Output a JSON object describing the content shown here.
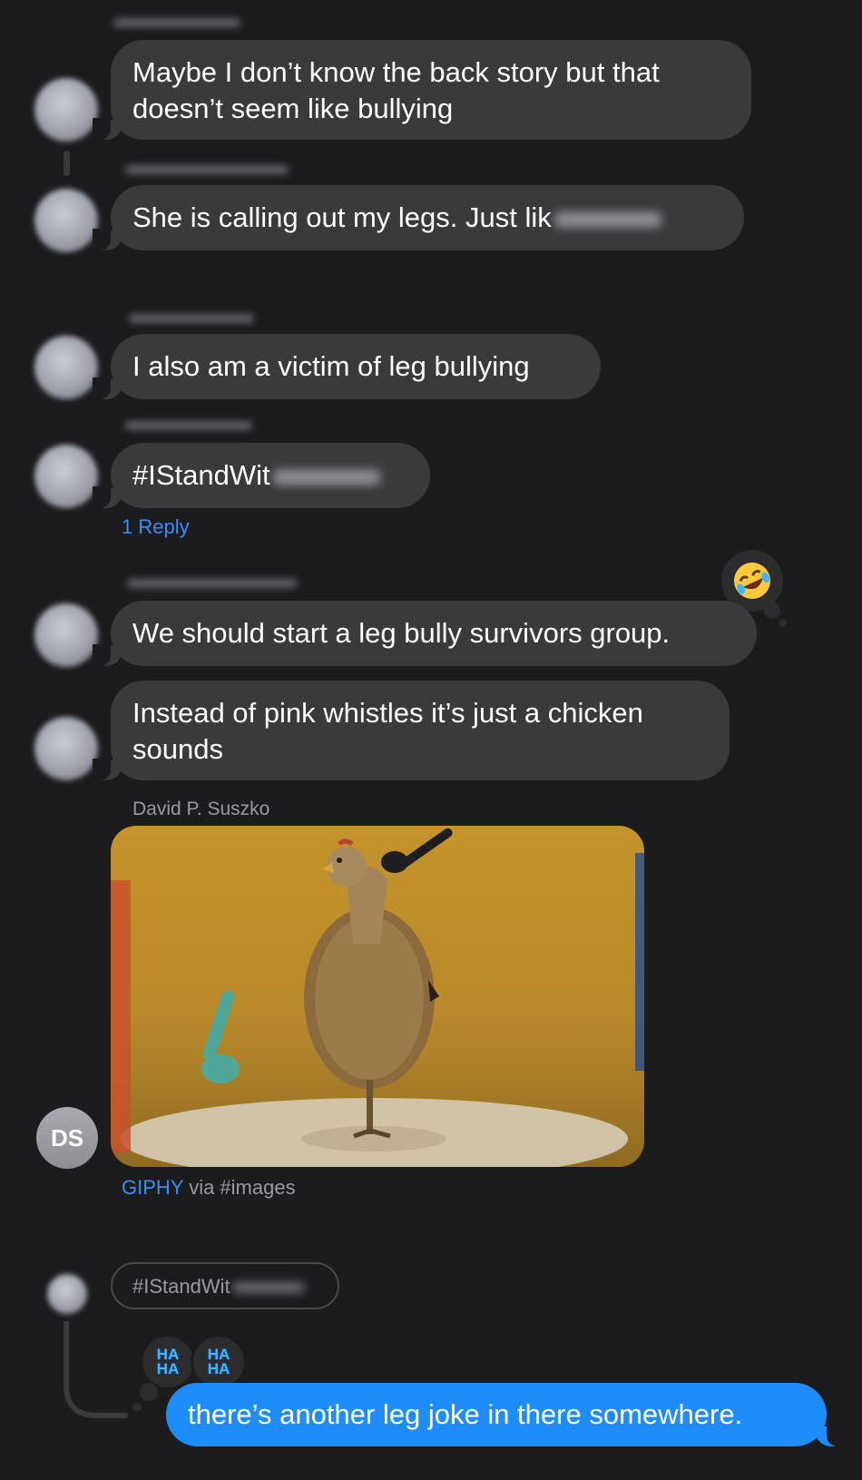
{
  "messages": [
    {
      "text": "Maybe I don’t know the back story but that doesn’t seem like bullying"
    },
    {
      "text": "She is calling out my legs. Just lik"
    },
    {
      "text": "I also am a victim of leg bullying"
    },
    {
      "text": "#IStandWit",
      "reply_count_label": "1 Reply"
    },
    {
      "text": "We should start a leg bully survivors group.",
      "reaction": "rolling-on-floor-laughing"
    },
    {
      "text": "Instead of pink whistles it’s just a chicken sounds"
    }
  ],
  "gif_message": {
    "sender_name": "David P. Suszko",
    "avatar_initials": "DS",
    "source_label": "GIPHY",
    "via_label": "via #images"
  },
  "reply_thread": {
    "quoted_text": "#IStandWit",
    "reactions": [
      "HA HA",
      "HA HA"
    ],
    "outgoing_text": "there’s another leg joke in there somewhere."
  },
  "colors": {
    "background": "#1c1c1e",
    "incoming_bubble": "#3a3a3c",
    "outgoing_bubble": "#1e8cfb",
    "link": "#3b8df6"
  }
}
